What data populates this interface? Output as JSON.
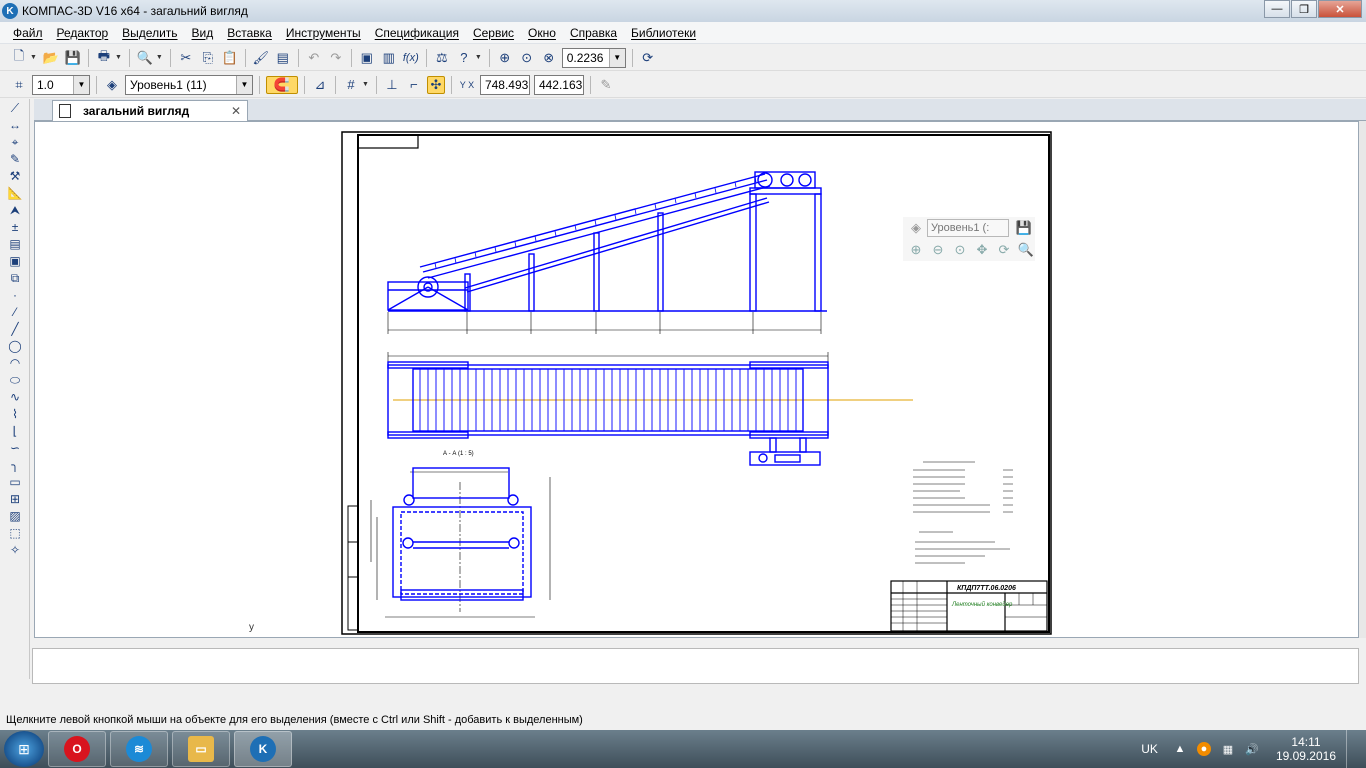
{
  "window": {
    "title": "КОМПАС-3D V16  x64 - загальний вигляд",
    "logo_letter": "K",
    "minimize": "—",
    "maximize": "❐",
    "close": "✕"
  },
  "menu": {
    "items": [
      "Файл",
      "Редактор",
      "Выделить",
      "Вид",
      "Вставка",
      "Инструменты",
      "Спецификация",
      "Сервис",
      "Окно",
      "Справка",
      "Библиотеки"
    ]
  },
  "toolbar1": {
    "zoom_value": "0.2236"
  },
  "toolbar2": {
    "line_scale": "1.0",
    "layer": "Уровень1 (11)",
    "coord_x": "748.493",
    "coord_y": "442.163"
  },
  "document_tab": {
    "label": "загальний вигляд",
    "close": "✕"
  },
  "floating_panel": {
    "layer_field": "Уровень1 (:"
  },
  "drawing": {
    "section_label": "А - А (1 : 5)",
    "title_block_code": "КПДП7ТТ.06.0206",
    "title_block_name": "Ленточный конвейер",
    "axis_marker": "y"
  },
  "status": {
    "message": "Щелкните левой кнопкой мыши на объекте для его выделения (вместе с Ctrl или Shift - добавить к выделенным)"
  },
  "taskbar": {
    "language": "UK",
    "time": "14:11",
    "date": "19.09.2016"
  },
  "colors": {
    "drawing_blue": "#0000ff",
    "sheet_black": "#000000",
    "accent_orange": "#e0a000"
  }
}
